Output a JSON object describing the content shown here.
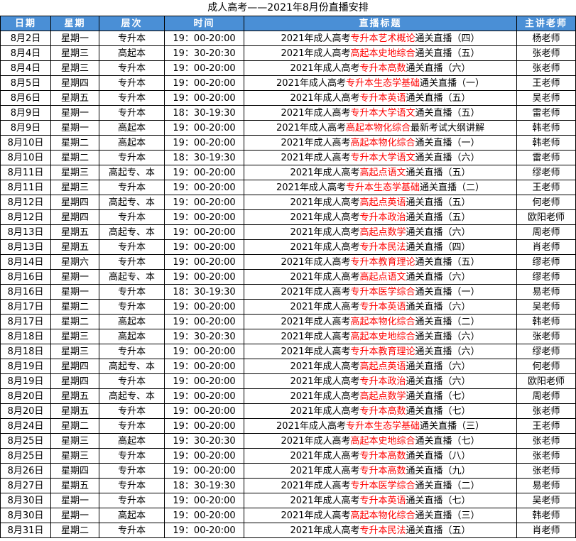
{
  "title": "成人高考——2021年8月份直播安排",
  "headers": [
    "日期",
    "星期",
    "层次",
    "时间",
    "直播标题",
    "主讲老师"
  ],
  "rows": [
    {
      "date": "8月2日",
      "weekday": "星期一",
      "level": "专升本",
      "time": "19：00-20:00",
      "pre": "2021年成人高考",
      "hl": "专升本艺术概论",
      "post": "通关直播（四）",
      "teacher": "杨老师"
    },
    {
      "date": "8月4日",
      "weekday": "星期三",
      "level": "高起本",
      "time": "19：30-20:30",
      "pre": "2021年成人高考",
      "hl": "高起本史地综合",
      "post": "通关直播（五）",
      "teacher": "张老师"
    },
    {
      "date": "8月4日",
      "weekday": "星期三",
      "level": "专升本",
      "time": "19：00-20:00",
      "pre": "2021年成人高考",
      "hl": "专升本高数",
      "post": "通关直播（六）",
      "teacher": "张老师"
    },
    {
      "date": "8月5日",
      "weekday": "星期四",
      "level": "专升本",
      "time": "19：00-20:00",
      "pre": "2021年成人高考",
      "hl": "专升本生态学基础",
      "post": "通关直播（一）",
      "teacher": "王老师"
    },
    {
      "date": "8月6日",
      "weekday": "星期五",
      "level": "专升本",
      "time": "19：00-20:00",
      "pre": "2021年成人高考",
      "hl": "专升本英语",
      "post": "通关直播（五）",
      "teacher": "吴老师"
    },
    {
      "date": "8月9日",
      "weekday": "星期一",
      "level": "专升本",
      "time": "18：30-19:30",
      "pre": "2021年成人高考",
      "hl": "专升本大学语文",
      "post": "通关直播（五）",
      "teacher": "雷老师"
    },
    {
      "date": "8月9日",
      "weekday": "星期一",
      "level": "高起本",
      "time": "19：00-20:00",
      "pre": "2021年成人高考",
      "hl": "高起本物化综合",
      "post": "最新考试大纲讲解",
      "teacher": "韩老师"
    },
    {
      "date": "8月10日",
      "weekday": "星期二",
      "level": "高起本",
      "time": "19：00-20:00",
      "pre": "2021年成人高考",
      "hl": "高起本物化综合",
      "post": "通关直播（一）",
      "teacher": "韩老师"
    },
    {
      "date": "8月10日",
      "weekday": "星期二",
      "level": "专升本",
      "time": "18：30-19:30",
      "pre": "2021年成人高考",
      "hl": "专升本大学语文",
      "post": "通关直播（六）",
      "teacher": "雷老师"
    },
    {
      "date": "8月11日",
      "weekday": "星期三",
      "level": "高起专、本",
      "time": "19：00-20:00",
      "pre": "2021年成人高考",
      "hl": "高起点语文",
      "post": "通关直播（五）",
      "teacher": "缪老师"
    },
    {
      "date": "8月11日",
      "weekday": "星期三",
      "level": "专升本",
      "time": "19：00-20:00",
      "pre": "2021年成人高考",
      "hl": "专升本生态学基础",
      "post": "通关直播（二）",
      "teacher": "王老师"
    },
    {
      "date": "8月12日",
      "weekday": "星期四",
      "level": "高起专、本",
      "time": "19：00-20:00",
      "pre": "2021年成人高考",
      "hl": "高起点英语",
      "post": "通关直播（五）",
      "teacher": "何老师"
    },
    {
      "date": "8月12日",
      "weekday": "星期四",
      "level": "专升本",
      "time": "19：00-20:00",
      "pre": "2021年成人高考",
      "hl": "专升本政治",
      "post": "通关直播（五）",
      "teacher": "欧阳老师"
    },
    {
      "date": "8月13日",
      "weekday": "星期五",
      "level": "高起专、本",
      "time": "19：00-20:00",
      "pre": "2021年成人高考",
      "hl": "高起点数学",
      "post": "通关直播（六）",
      "teacher": "周老师"
    },
    {
      "date": "8月13日",
      "weekday": "星期五",
      "level": "专升本",
      "time": "19：00-20:00",
      "pre": "2021年成人高考",
      "hl": "专升本民法",
      "post": "通关直播（四）",
      "teacher": "肖老师"
    },
    {
      "date": "8月14日",
      "weekday": "星期六",
      "level": "专升本",
      "time": "19：00-20:00",
      "pre": "2021年成人高考",
      "hl": "专升本教育理论",
      "post": "通关直播（五）",
      "teacher": "缪老师"
    },
    {
      "date": "8月16日",
      "weekday": "星期一",
      "level": "高起专、本",
      "time": "19：00-20:00",
      "pre": "2021年成人高考",
      "hl": "高起点语文",
      "post": "通关直播（六）",
      "teacher": "缪老师"
    },
    {
      "date": "8月16日",
      "weekday": "星期一",
      "level": "专升本",
      "time": "18：30-19:30",
      "pre": "2021年成人高考",
      "hl": "专升本医学综合",
      "post": "通关直播（一）",
      "teacher": "易老师"
    },
    {
      "date": "8月17日",
      "weekday": "星期二",
      "level": "专升本",
      "time": "19：00-20:00",
      "pre": "2021年成人高考",
      "hl": "专升本英语",
      "post": "通关直播（六）",
      "teacher": "吴老师"
    },
    {
      "date": "8月17日",
      "weekday": "星期二",
      "level": "高起本",
      "time": "19：00-20:00",
      "pre": "2021年成人高考",
      "hl": "高起本物化综合",
      "post": "通关直播（二）",
      "teacher": "韩老师"
    },
    {
      "date": "8月18日",
      "weekday": "星期三",
      "level": "高起本",
      "time": "19：30-20:30",
      "pre": "2021年成人高考",
      "hl": "高起本史地综合",
      "post": "通关直播（六）",
      "teacher": "张老师"
    },
    {
      "date": "8月18日",
      "weekday": "星期三",
      "level": "专升本",
      "time": "19：00-20:00",
      "pre": "2021年成人高考",
      "hl": "专升本教育理论",
      "post": "通关直播（六）",
      "teacher": "缪老师"
    },
    {
      "date": "8月19日",
      "weekday": "星期四",
      "level": "高起专、本",
      "time": "19：00-20:00",
      "pre": "2021年成人高考",
      "hl": "高起点英语",
      "post": "通关直播（六）",
      "teacher": "何老师"
    },
    {
      "date": "8月19日",
      "weekday": "星期四",
      "level": "专升本",
      "time": "19：00-20:00",
      "pre": "2021年成人高考",
      "hl": "专升本政治",
      "post": "通关直播（六）",
      "teacher": "欧阳老师"
    },
    {
      "date": "8月20日",
      "weekday": "星期五",
      "level": "高起专、本",
      "time": "19：00-20:00",
      "pre": "2021年成人高考",
      "hl": "高起点数学",
      "post": "通关直播（七）",
      "teacher": "周老师"
    },
    {
      "date": "8月20日",
      "weekday": "星期五",
      "level": "专升本",
      "time": "19：00-20:00",
      "pre": "2021年成人高考",
      "hl": "专升本高数",
      "post": "通关直播（七）",
      "teacher": "张老师"
    },
    {
      "date": "8月24日",
      "weekday": "星期二",
      "level": "专升本",
      "time": "19：00-20:00",
      "pre": "2021年成人高考",
      "hl": "专升本生态学基础",
      "post": "通关直播（三）",
      "teacher": "王老师"
    },
    {
      "date": "8月25日",
      "weekday": "星期三",
      "level": "高起本",
      "time": "19：30-20:30",
      "pre": "2021年成人高考",
      "hl": "高起本史地综合",
      "post": "通关直播（七）",
      "teacher": "张老师"
    },
    {
      "date": "8月25日",
      "weekday": "星期三",
      "level": "专升本",
      "time": "19：00-20:00",
      "pre": "2021年成人高考",
      "hl": "专升本高数",
      "post": "通关直播（八）",
      "teacher": "张老师"
    },
    {
      "date": "8月26日",
      "weekday": "星期四",
      "level": "专升本",
      "time": "19：00-20:00",
      "pre": "2021年成人高考",
      "hl": "专升本高数",
      "post": "通关直播（九）",
      "teacher": "张老师"
    },
    {
      "date": "8月27日",
      "weekday": "星期五",
      "level": "专升本",
      "time": "18：30-19:30",
      "pre": "2021年成人高考",
      "hl": "专升本医学综合",
      "post": "通关直播（二）",
      "teacher": "易老师"
    },
    {
      "date": "8月30日",
      "weekday": "星期一",
      "level": "专升本",
      "time": "19：00-20:00",
      "pre": "2021年成人高考",
      "hl": "专升本英语",
      "post": "通关直播（七）",
      "teacher": "吴老师"
    },
    {
      "date": "8月30日",
      "weekday": "星期一",
      "level": "高起本",
      "time": "19：00-20:00",
      "pre": "2021年成人高考",
      "hl": "高起本物化综合",
      "post": "通关直播（三）",
      "teacher": "韩老师"
    },
    {
      "date": "8月31日",
      "weekday": "星期二",
      "level": "专升本",
      "time": "19：00-20:00",
      "pre": "2021年成人高考",
      "hl": "专升本民法",
      "post": "通关直播（五）",
      "teacher": "肖老师"
    }
  ],
  "colors": {
    "header_bg": "#4a8fd6",
    "header_text": "#ffffff",
    "highlight": "#ff0000"
  }
}
